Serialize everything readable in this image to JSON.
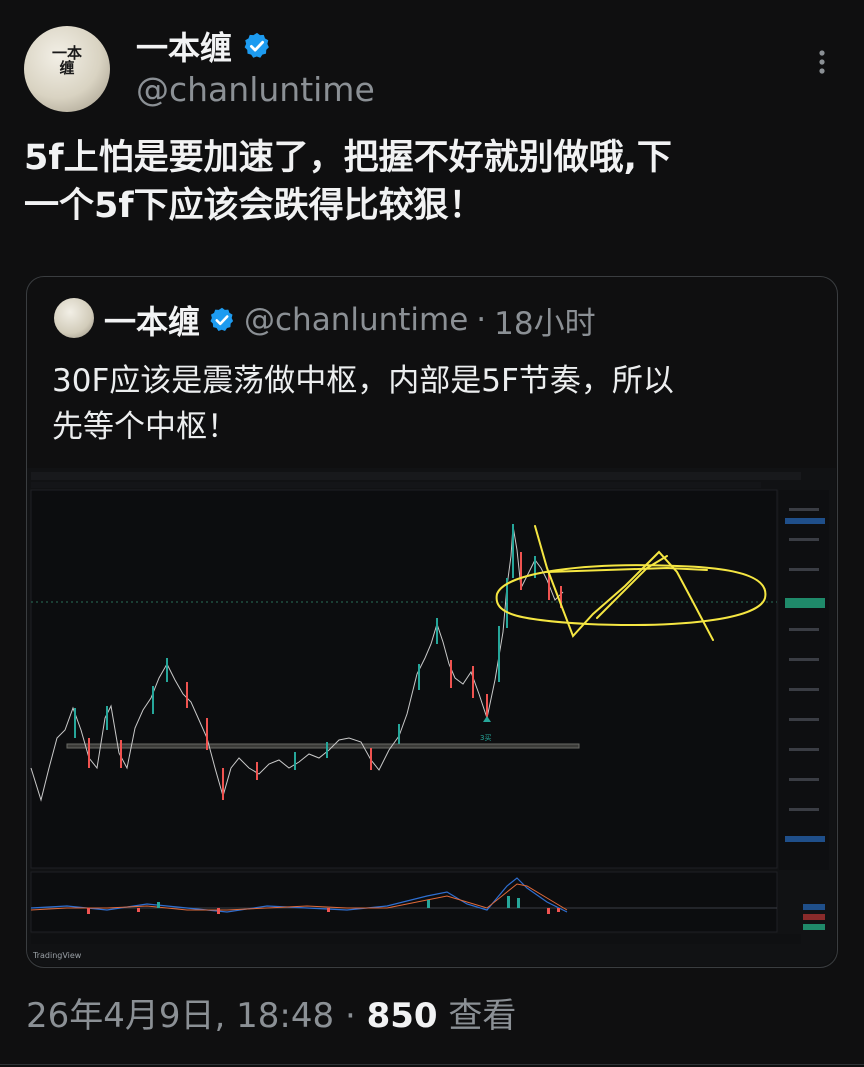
{
  "author": {
    "display_name": "一本缠",
    "handle": "@chanluntime",
    "avatar_seal_text": "一本缠",
    "verified_color": "#1d9bf0"
  },
  "tweet": {
    "lines": [
      "5f上怕是要加速了，把握不好就别做哦,下",
      "一个5f下应该会跌得比较狠！"
    ]
  },
  "quoted_tweet": {
    "display_name": "一本缠",
    "handle": "@chanluntime",
    "separator": "·",
    "time": "18小时",
    "lines": [
      "30F应该是震荡做中枢，内部是5F节奏，所以",
      "先等个中枢！"
    ]
  },
  "chart_image": {
    "watermark": "TradingView",
    "marker_label": "3买"
  },
  "footer": {
    "date": "26年4月9日, 18:48",
    "separator": "·",
    "views": "850",
    "views_label": "查看"
  },
  "colors": {
    "background": "#0f0f10",
    "up_candle": "#26a69a",
    "down_candle": "#ef5350",
    "annotation": "#f5e642",
    "muted_text": "#8b9095"
  }
}
